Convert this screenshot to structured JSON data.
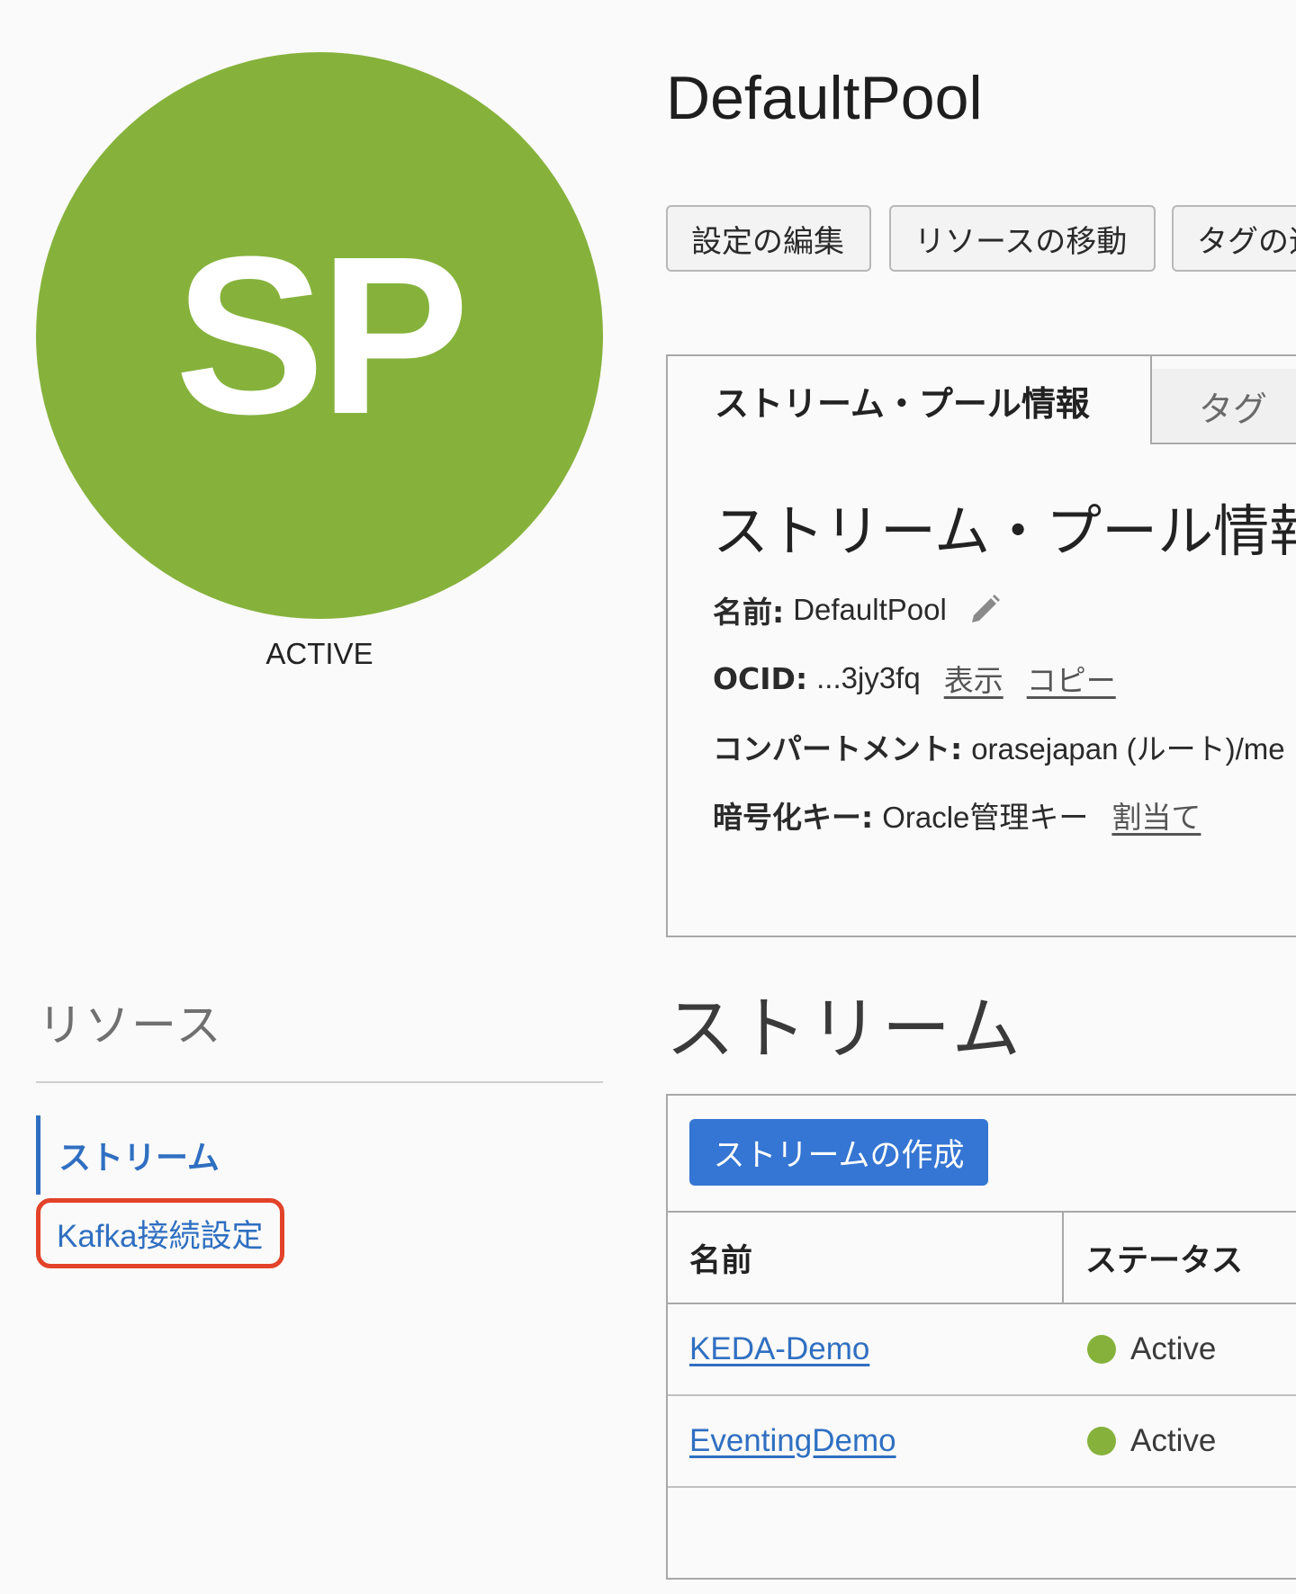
{
  "avatar": {
    "initials": "SP",
    "status": "ACTIVE"
  },
  "resources": {
    "heading": "リソース",
    "items": [
      {
        "label": "ストリーム",
        "active": true
      },
      {
        "label": "Kafka接続設定",
        "active": false,
        "highlighted": true
      }
    ]
  },
  "page": {
    "title": "DefaultPool"
  },
  "actions": {
    "edit_settings": "設定の編集",
    "move_resource": "リソースの移動",
    "add_tags": "タグの追加"
  },
  "tabs": [
    {
      "label": "ストリーム・プール情報",
      "active": true
    },
    {
      "label": "タグ",
      "active": false
    }
  ],
  "info": {
    "heading": "ストリーム・プール情報",
    "name_label": "名前:",
    "name_value": "DefaultPool",
    "ocid_label": "OCID:",
    "ocid_value": "...3jy3fq",
    "ocid_show": "表示",
    "ocid_copy": "コピー",
    "compartment_label": "コンパートメント:",
    "compartment_value": "orasejapan (ルート)/me",
    "encryption_label": "暗号化キー:",
    "encryption_value": "Oracle管理キー",
    "encryption_assign": "割当て"
  },
  "streams": {
    "heading": "ストリーム",
    "create_button": "ストリームの作成",
    "columns": [
      "名前",
      "ステータス"
    ],
    "rows": [
      {
        "name": "KEDA-Demo",
        "status": "Active"
      },
      {
        "name": "EventingDemo",
        "status": "Active"
      }
    ]
  },
  "colors": {
    "avatar_green": "#86b23c",
    "link_blue": "#2f6fc1",
    "primary_button": "#3575d3",
    "highlight_red": "#e24329",
    "status_active": "#86b23c"
  }
}
